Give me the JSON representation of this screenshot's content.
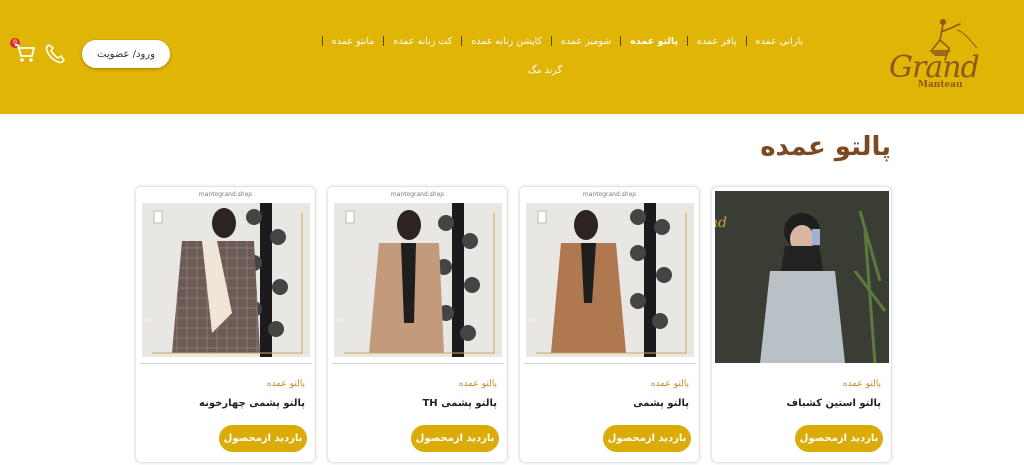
{
  "header": {
    "login_label": "ورود/ عضویت",
    "cart_count": "0",
    "nav": [
      {
        "label": "بارانی عمده",
        "active": false
      },
      {
        "label": "پافر عمده",
        "active": false
      },
      {
        "label": "پالتو عمده",
        "active": true
      },
      {
        "label": "شومیز عمده",
        "active": false
      },
      {
        "label": "کاپشن زنانه عمده",
        "active": false
      },
      {
        "label": "کت زنانه عمده",
        "active": false
      },
      {
        "label": "مانتو عمده",
        "active": false
      }
    ],
    "nav_row2": "گرند مگ",
    "logo_text": "Grand",
    "logo_sub": "Manteau"
  },
  "page": {
    "title": "پالتو عمده"
  },
  "products": [
    {
      "category": "پالتو عمده",
      "name": "پالتو استین کشباف",
      "button": "بازدید ازمحصول",
      "watermark": "",
      "badge": ""
    },
    {
      "category": "پالتو عمده",
      "name": "پالتو پشمی",
      "button": "بازدید ازمحصول",
      "watermark": "mantogrand.shop",
      "badge": "NEW COLLECTION"
    },
    {
      "category": "پالتو عمده",
      "name": "پالتو پشمی TH",
      "button": "بازدید ازمحصول",
      "watermark": "mantogrand.shop",
      "badge": "NEW COLLECTION"
    },
    {
      "category": "پالتو عمده",
      "name": "پالتو پشمی چهارخونه",
      "button": "بازدید ازمحصول",
      "watermark": "mantogrand.shop",
      "badge": "NEW COLLECTION"
    }
  ],
  "colors": {
    "header_bg": "#e1b505",
    "accent": "#dbac08",
    "title": "#7b4a22"
  }
}
